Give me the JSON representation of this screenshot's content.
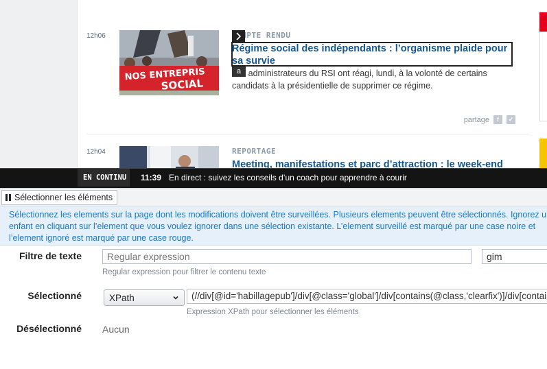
{
  "articles": [
    {
      "time": "12h06",
      "kicker": "COMPTE RENDU",
      "title": "Régime social des indépendants : l’organisme plaide pour sa survie",
      "description": "Les administrateurs du RSI ont réagi, lundi, à la volonté de certains candidats à la présidentielle de supprimer ce régime.",
      "share_label": "partage",
      "photo_text": "NOS ENTREPRIS SOCIAL"
    },
    {
      "time": "12h04",
      "kicker": "REPORTAGE",
      "title": "Meeting, manifestations et parc d’attraction : le week-end"
    }
  ],
  "selection_badge_letter": "a",
  "ticker": {
    "tag": "EN CONTINU",
    "time": "11:39",
    "text": "En direct : suivez les conseils d’un coach pour apprendre à courir"
  },
  "picker": {
    "tab_label": "Sélectionner les éléments",
    "help_text": "Sélectionnez les elements sur la page dont les modifications doivent être surveillées. Plusieurs elements peuvent être sélectionnés. Ignorez un enfant en cliquant sur l’element que vous voulez ignorer dans une sélection existante. L’element surveillé est marqué par une case noire et l’element ignoré est marqué par une case rouge.",
    "text_filter": {
      "label": "Filtre de texte",
      "placeholder": "Regular expression",
      "flags_value": "gim",
      "hint": "Regular expression pour filtrer le contenu texte"
    },
    "selected": {
      "label": "Sélectionné",
      "mode_value": "XPath",
      "xpath_value": "(//div[@id='habillagepub']/div[@class='global']/div[contains(@class,'clearfix')]/div[contains(@class,'col_gauche')]",
      "hint": "Expression XPath pour sélectionner les éléments"
    },
    "deselected": {
      "label": "Désélectionné",
      "value": "Aucun"
    }
  },
  "colors": {
    "link_blue": "#16578e",
    "help_blue": "#1877c6",
    "help_bg": "#e6f0fa",
    "ticker_bg": "#141414",
    "brand_red": "#e2001a"
  }
}
